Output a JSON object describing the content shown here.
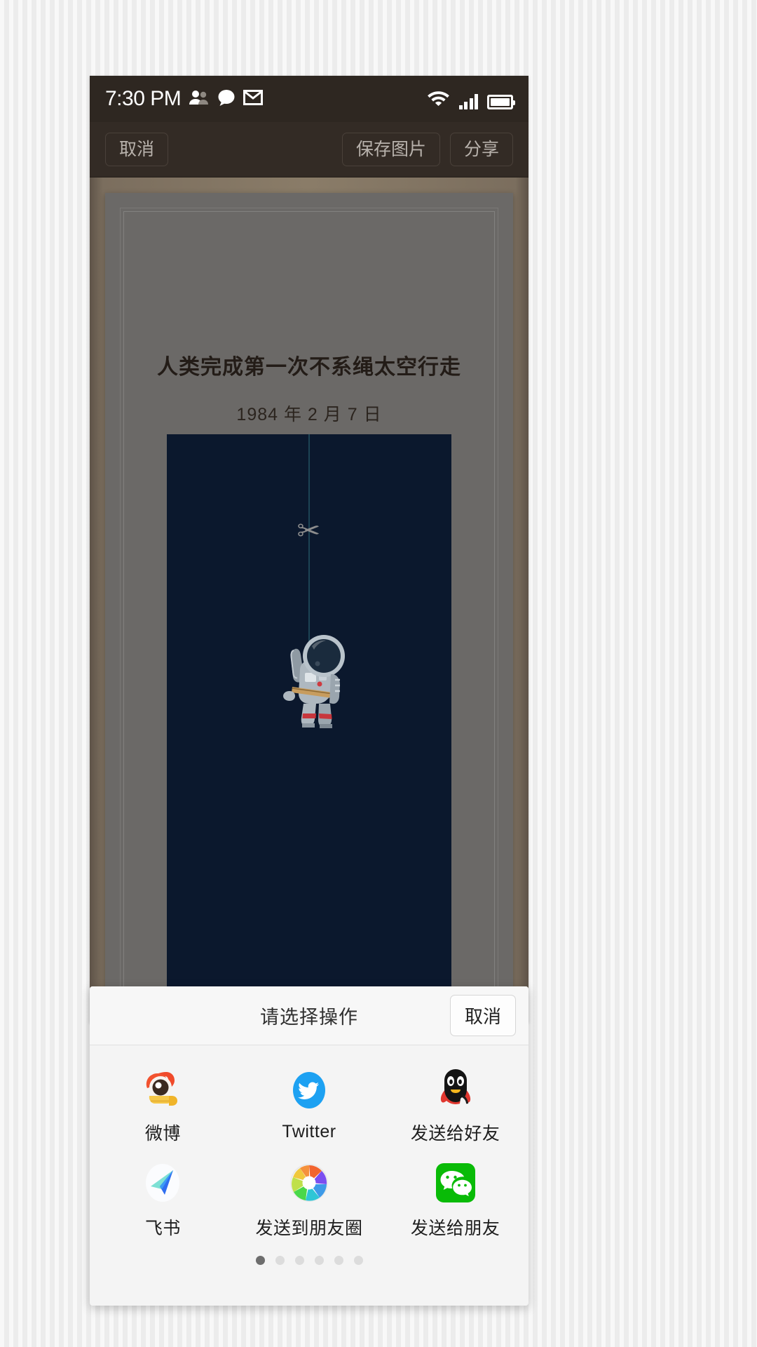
{
  "status_bar": {
    "time": "7:30 PM",
    "left_icons": [
      "people-icon",
      "chat-bubble-icon",
      "envelope-icon"
    ],
    "right_icons": [
      "wifi-icon",
      "signal-bars-icon",
      "battery-icon"
    ],
    "signal_bars": 4,
    "background_color": "#2e2721"
  },
  "toolbar": {
    "cancel_label": "取消",
    "save_label": "保存图片",
    "share_label": "分享",
    "background_color": "#332b25"
  },
  "card": {
    "title": "人类完成第一次不系绳太空行走",
    "date": "1984 年 2 月 7 日",
    "card_color": "#6b6967",
    "illustration_background": "#0b182d",
    "illustration_elements": [
      "tether-line",
      "scissors-icon",
      "astronaut-figure"
    ]
  },
  "share_sheet": {
    "title": "请选择操作",
    "cancel_label": "取消",
    "apps": [
      {
        "label": "微博",
        "icon": "weibo-icon",
        "color": "#e6451f"
      },
      {
        "label": "Twitter",
        "icon": "twitter-icon",
        "color": "#1da1f2"
      },
      {
        "label": "发送给好友",
        "icon": "qq-icon",
        "color": "#12b7f5"
      },
      {
        "label": "飞书",
        "icon": "feishu-icon",
        "color": "#2f88ff"
      },
      {
        "label": "发送到朋友圈",
        "icon": "wechat-moments-icon",
        "color": "#f5a623"
      },
      {
        "label": "发送给朋友",
        "icon": "wechat-icon",
        "color": "#09bb07"
      }
    ],
    "page_dots": {
      "count": 6,
      "active_index": 0
    }
  }
}
